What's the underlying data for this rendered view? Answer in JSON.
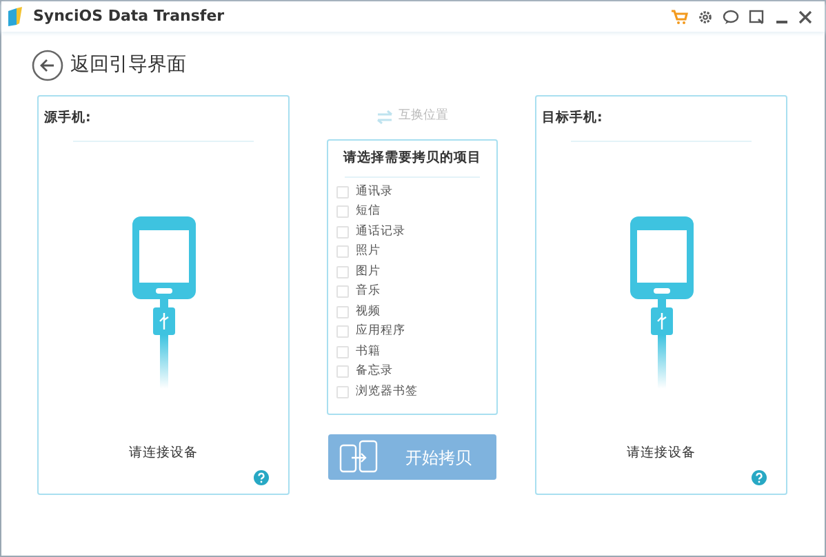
{
  "window": {
    "title": "SynciOS Data Transfer"
  },
  "back": {
    "label": "返回引导界面"
  },
  "source": {
    "title": "源手机:",
    "status": "请连接设备"
  },
  "swap": {
    "label": "互换位置",
    "disabled": true
  },
  "items_panel": {
    "title": "请选择需要拷贝的项目",
    "items": [
      {
        "label": "通讯录",
        "checked": false
      },
      {
        "label": "短信",
        "checked": false
      },
      {
        "label": "通话记录",
        "checked": false
      },
      {
        "label": "照片",
        "checked": false
      },
      {
        "label": "图片",
        "checked": false
      },
      {
        "label": "音乐",
        "checked": false
      },
      {
        "label": "视频",
        "checked": false
      },
      {
        "label": "应用程序",
        "checked": false
      },
      {
        "label": "书籍",
        "checked": false
      },
      {
        "label": "备忘录",
        "checked": false
      },
      {
        "label": "浏览器书签",
        "checked": false
      }
    ]
  },
  "start": {
    "label": "开始拷贝",
    "disabled": true
  },
  "target": {
    "title": "目标手机:",
    "status": "请连接设备"
  }
}
